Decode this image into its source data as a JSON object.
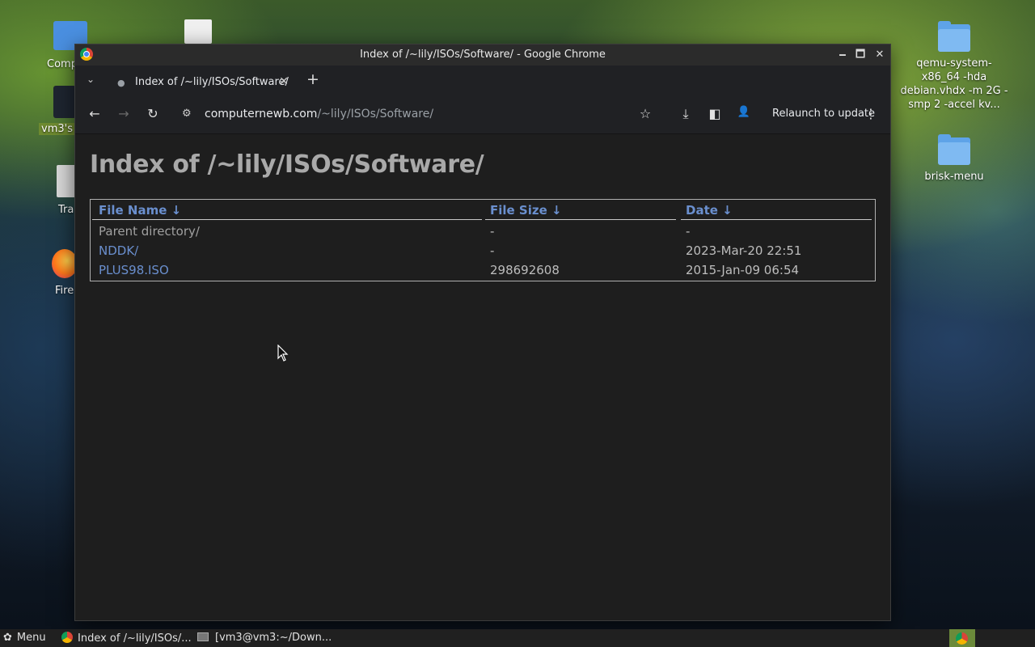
{
  "desktop": {
    "right_icons": [
      {
        "label": "qemu-system-x86_64 -hda debian.vhdx -m 2G -smp 2 -accel kv..."
      },
      {
        "label": "brisk-menu"
      }
    ],
    "left_partial_labels": [
      "Comp",
      "vm3's",
      "Tra",
      "Fire"
    ]
  },
  "window": {
    "title": "Index of /~lily/ISOs/Software/ - Google Chrome",
    "minimize": "🗕",
    "maximize": "🗖",
    "close": "✕"
  },
  "tabs": {
    "list_icon": "⌄",
    "active_tab_label": "Index of /~lily/ISOs/Software/",
    "close_icon": "✕",
    "new_tab_icon": "+"
  },
  "toolbar": {
    "back_icon": "←",
    "forward_icon": "→",
    "reload_icon": "↻",
    "site_info_icon": "⚙",
    "url_host": "computernewb.com",
    "url_path": "/~lily/ISOs/Software/",
    "bookmark_icon": "☆",
    "download_icon": "⤓",
    "sidepanel_icon": "◧",
    "profile_icon": "👤",
    "relaunch_label": "Relaunch to update",
    "menu_icon": "⋮"
  },
  "page": {
    "heading": "Index of /~lily/ISOs/Software/",
    "columns": {
      "name": "File Name ↓",
      "size": "File Size ↓",
      "date": "Date ↓"
    },
    "rows": [
      {
        "name": "Parent directory/",
        "size": "-",
        "date": "-"
      },
      {
        "name": "NDDK/",
        "size": "-",
        "date": "2023-Mar-20 22:51"
      },
      {
        "name": "PLUS98.ISO",
        "size": "298692608",
        "date": "2015-Jan-09 06:54"
      }
    ]
  },
  "taskbar": {
    "menu_label": "Menu",
    "chrome_task": "Index of /~lily/ISOs/...",
    "terminal_task": "[vm3@vm3:~/Down..."
  },
  "colors": {
    "link": "#6a8fce",
    "page_bg": "#1e1e1e",
    "heading": "#a9a9a9"
  }
}
